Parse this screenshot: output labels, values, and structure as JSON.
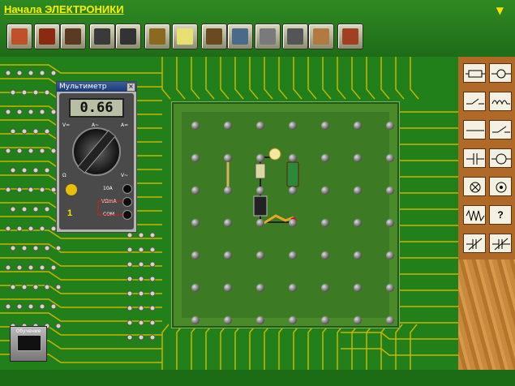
{
  "app": {
    "title": "Начала ЭЛЕКТРОНИКИ",
    "menu_icon": "yellow-triangle-down-icon"
  },
  "toolbar": {
    "buttons": [
      {
        "name": "magnifier-tool-icon",
        "color": "#c0502a"
      },
      {
        "name": "delete-tool-icon",
        "color": "#8a2a10"
      },
      {
        "name": "cut-tool-icon",
        "color": "#5a3a20"
      },
      {
        "name": "voltmeter-icon",
        "color": "#3a3a3a"
      },
      {
        "name": "oscilloscope-icon",
        "color": "#333333"
      },
      {
        "name": "probe-tool-icon",
        "color": "#8a6a20"
      },
      {
        "name": "notes-icon",
        "color": "#e8e070"
      },
      {
        "name": "books-icon",
        "color": "#6a4a20"
      },
      {
        "name": "flasks-icon",
        "color": "#4a6a8a"
      },
      {
        "name": "component-box-icon",
        "color": "#7a7a7a"
      },
      {
        "name": "calculator-icon",
        "color": "#555555"
      },
      {
        "name": "teacher-icon",
        "color": "#b07a40"
      },
      {
        "name": "door-exit-icon",
        "color": "#a04020"
      }
    ]
  },
  "multimeter": {
    "window_title": "Мультиметр",
    "close_label": "×",
    "reading": "0.66",
    "mode_number": "1",
    "jack_labels": [
      "10A",
      "VΩmA",
      "COM"
    ],
    "mode_labels": [
      "V=",
      "A=",
      "Ω",
      "V~",
      "A~"
    ]
  },
  "palette": {
    "items": [
      "resistor-icon",
      "lamp-icon",
      "switch-key-icon",
      "inductor-coil-icon",
      "wire-icon",
      "switch-icon",
      "capacitor-icon",
      "ammeter-icon",
      "lamp-cross-icon",
      "voltmeter-round-icon",
      "ac-source-icon",
      "help-question-icon",
      "variable-resistor-icon",
      "variable-capacitor-icon"
    ],
    "help_label": "?"
  },
  "exit_button": {
    "label": "Обучение"
  },
  "colors": {
    "pcb_green": "#21801a",
    "trace_yellow": "#c8b400",
    "title_yellow": "#f6f000",
    "board_green": "#3c7a24"
  }
}
